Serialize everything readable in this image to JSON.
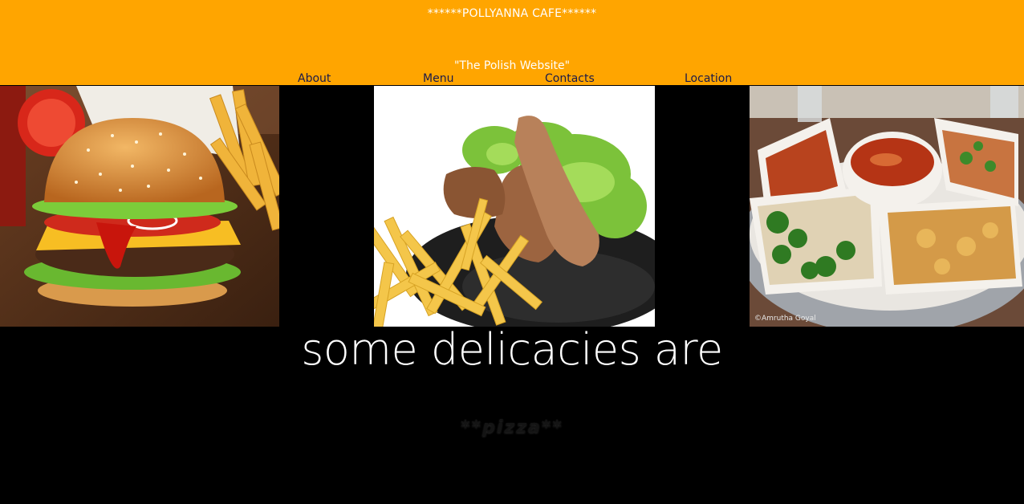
{
  "header": {
    "title": "******POLLYANNA CAFE******",
    "subtitle": "\"The Polish Website\"",
    "background": "#FFA500"
  },
  "nav": {
    "items": [
      {
        "label": "About"
      },
      {
        "label": "Menu"
      },
      {
        "label": "Contacts"
      },
      {
        "label": "Location"
      }
    ]
  },
  "gallery": {
    "images": [
      {
        "name": "burger-and-fries-photo"
      },
      {
        "name": "chicken-and-fries-photo"
      },
      {
        "name": "food-platter-photo",
        "caption": "©Amrutha Goyal"
      }
    ]
  },
  "section": {
    "heading": "some delicacies are",
    "item": "**pizza**"
  }
}
